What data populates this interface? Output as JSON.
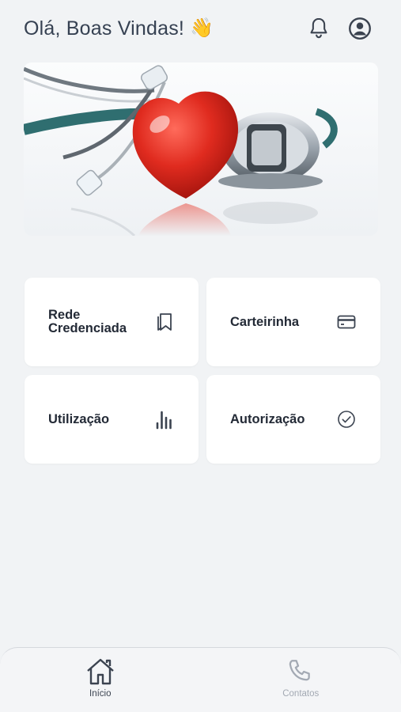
{
  "header": {
    "greeting": "Olá, Boas Vindas!",
    "wave_emoji": "👋",
    "notification_icon": "bell-icon",
    "profile_icon": "user-circle-icon"
  },
  "banner": {
    "image_icon": "stethoscope-heart-image"
  },
  "menu": {
    "items": [
      {
        "label": "Rede\nCredenciada",
        "icon": "bookmark-icon"
      },
      {
        "label": "Carteirinha",
        "icon": "card-icon"
      },
      {
        "label": "Utilização",
        "icon": "bar-chart-icon"
      },
      {
        "label": "Autorização",
        "icon": "check-circle-icon"
      }
    ]
  },
  "tabbar": {
    "tabs": [
      {
        "label": "Início",
        "icon": "home-icon",
        "active": true
      },
      {
        "label": "Contatos",
        "icon": "phone-icon",
        "active": false
      }
    ]
  },
  "colors": {
    "background": "#f1f3f5",
    "card": "#ffffff",
    "icon": "#3b4350",
    "tab_inactive": "#a3a9b3",
    "heart": "#d9251c"
  }
}
